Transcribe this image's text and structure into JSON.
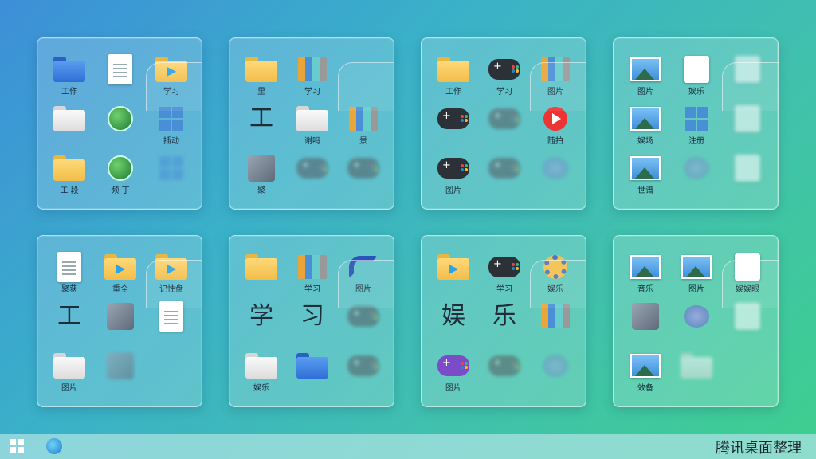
{
  "fences": [
    {
      "name": "fence-1",
      "tiles": [
        {
          "icon": "blue-folder-icon",
          "kind": "folder-blue",
          "label": "工作"
        },
        {
          "icon": "document-icon",
          "kind": "doc",
          "label": ""
        },
        {
          "icon": "media-folder-icon",
          "kind": "folder-yellow-play",
          "label": "学习"
        },
        {
          "icon": "white-folder-icon",
          "kind": "folder-white",
          "label": ""
        },
        {
          "icon": "clock-icon",
          "kind": "globe",
          "label": ""
        },
        {
          "icon": "windows-icon",
          "kind": "win",
          "label": "插动"
        },
        {
          "icon": "yellow-folder-icon",
          "kind": "folder-yellow",
          "label": "工 段"
        },
        {
          "icon": "globe-icon",
          "kind": "globe",
          "label": "频 丁"
        },
        {
          "icon": "blurred-icon",
          "kind": "win-blur",
          "label": ""
        }
      ]
    },
    {
      "name": "fence-2",
      "tiles": [
        {
          "icon": "yellow-folder-icon",
          "kind": "folder-yellow",
          "label": "里"
        },
        {
          "icon": "green-book-icon",
          "kind": "books",
          "label": "学习"
        },
        {
          "icon": "empty-icon",
          "kind": "none",
          "label": ""
        },
        {
          "icon": "work-icon",
          "kind": "char",
          "char": "工",
          "label": ""
        },
        {
          "icon": "white-folder-icon",
          "kind": "folder-white",
          "label": "谢吗"
        },
        {
          "icon": "binder-icon",
          "kind": "books",
          "label": "景"
        },
        {
          "icon": "tools-icon",
          "kind": "tool",
          "label": "聚"
        },
        {
          "icon": "blurred-gamepad-icon",
          "kind": "pad-grey-blur",
          "label": ""
        },
        {
          "icon": "blurred-gamepad-icon",
          "kind": "pad-grey-blur",
          "label": ""
        }
      ]
    },
    {
      "name": "fence-3",
      "tiles": [
        {
          "icon": "yellow-folder-icon",
          "kind": "folder-yellow",
          "label": "工作"
        },
        {
          "icon": "gamepad-icon",
          "kind": "pad",
          "label": "学习"
        },
        {
          "icon": "books-icon",
          "kind": "books",
          "label": "图片"
        },
        {
          "icon": "gamepad-icon",
          "kind": "pad",
          "label": ""
        },
        {
          "icon": "blurred-gamepad-icon",
          "kind": "pad-grey-blur",
          "label": ""
        },
        {
          "icon": "play-icon",
          "kind": "play",
          "label": "随拍"
        },
        {
          "icon": "gamepad-icon",
          "kind": "pad",
          "label": "图片"
        },
        {
          "icon": "blurred-gamepad-icon",
          "kind": "pad-grey-blur",
          "label": ""
        },
        {
          "icon": "blurred-bubble-icon",
          "kind": "bubble-blur",
          "label": ""
        }
      ]
    },
    {
      "name": "fence-4",
      "tiles": [
        {
          "icon": "picture-folder-icon",
          "kind": "pic",
          "label": "图片"
        },
        {
          "icon": "app-grid-icon",
          "kind": "panel",
          "label": "娱乐"
        },
        {
          "icon": "blurred-icon",
          "kind": "panel-blur",
          "label": ""
        },
        {
          "icon": "photo-icon",
          "kind": "pic",
          "label": "娱场"
        },
        {
          "icon": "puzzle-icon",
          "kind": "win",
          "label": "注册"
        },
        {
          "icon": "blurred-icon",
          "kind": "panel-blur",
          "label": ""
        },
        {
          "icon": "landscape-icon",
          "kind": "pic",
          "label": "世谱"
        },
        {
          "icon": "blurred-globe-icon",
          "kind": "bubble-blur",
          "label": ""
        },
        {
          "icon": "blurred-icon",
          "kind": "panel-blur",
          "label": ""
        }
      ]
    },
    {
      "name": "fence-5",
      "tiles": [
        {
          "icon": "document-icon",
          "kind": "doc",
          "label": "聚获"
        },
        {
          "icon": "media-folder-icon",
          "kind": "folder-yellow-play",
          "label": "重全"
        },
        {
          "icon": "media-folder-icon",
          "kind": "folder-yellow-play",
          "label": "记性盘"
        },
        {
          "icon": "work-icon",
          "kind": "char",
          "char": "工",
          "label": ""
        },
        {
          "icon": "tools-icon",
          "kind": "tool",
          "label": ""
        },
        {
          "icon": "calculator-icon",
          "kind": "doc",
          "label": ""
        },
        {
          "icon": "white-folder-icon",
          "kind": "folder-white",
          "label": "图片"
        },
        {
          "icon": "blurred-tools-icon",
          "kind": "tool-blur",
          "label": ""
        },
        {
          "icon": "empty-icon",
          "kind": "none",
          "label": ""
        }
      ]
    },
    {
      "name": "fence-6",
      "tiles": [
        {
          "icon": "yellow-folder-icon",
          "kind": "folder-yellow",
          "label": ""
        },
        {
          "icon": "book-stack-icon",
          "kind": "books",
          "label": "学习"
        },
        {
          "icon": "phone-icon",
          "kind": "phone",
          "label": "图片"
        },
        {
          "icon": "study-xue-icon",
          "kind": "char",
          "char": "学",
          "label": ""
        },
        {
          "icon": "study-xi-icon",
          "kind": "char",
          "char": "习",
          "label": ""
        },
        {
          "icon": "blurred-gamepad-icon",
          "kind": "pad-grey-blur",
          "label": ""
        },
        {
          "icon": "white-folder-icon",
          "kind": "folder-white",
          "label": "娱乐"
        },
        {
          "icon": "blue-folders-icon",
          "kind": "folder-blue",
          "label": ""
        },
        {
          "icon": "blurred-gamepad-icon",
          "kind": "pad-grey-blur",
          "label": ""
        }
      ]
    },
    {
      "name": "fence-7",
      "tiles": [
        {
          "icon": "media-folder-icon",
          "kind": "folder-yellow-play",
          "label": ""
        },
        {
          "icon": "gamepad-icon",
          "kind": "pad",
          "label": "学习"
        },
        {
          "icon": "settings-folder-icon",
          "kind": "gear",
          "label": "娱乐"
        },
        {
          "icon": "entertain-yu-icon",
          "kind": "char",
          "char": "娱",
          "label": ""
        },
        {
          "icon": "entertain-le-icon",
          "kind": "char",
          "char": "乐",
          "label": ""
        },
        {
          "icon": "library-icon",
          "kind": "books",
          "label": ""
        },
        {
          "icon": "purple-gamepad-icon",
          "kind": "pad-purple",
          "label": "图片"
        },
        {
          "icon": "blurred-gamepad-icon",
          "kind": "pad-grey-blur",
          "label": ""
        },
        {
          "icon": "blurred-bubble-icon",
          "kind": "bubble-blur",
          "label": ""
        }
      ]
    },
    {
      "name": "fence-8",
      "tiles": [
        {
          "icon": "picture-folder-icon",
          "kind": "pic",
          "label": "音乐"
        },
        {
          "icon": "photo-folder-icon",
          "kind": "pic",
          "label": "图片"
        },
        {
          "icon": "calendar-icon",
          "kind": "panel",
          "label": "娱娱眼"
        },
        {
          "icon": "paint-icon",
          "kind": "tool",
          "label": ""
        },
        {
          "icon": "editor-icon",
          "kind": "bubble",
          "label": ""
        },
        {
          "icon": "blurred-icon",
          "kind": "panel-blur",
          "label": ""
        },
        {
          "icon": "photo-icon",
          "kind": "pic",
          "label": "效备"
        },
        {
          "icon": "blurred-folder-icon",
          "kind": "folder-white-blur",
          "label": ""
        },
        {
          "icon": "empty-icon",
          "kind": "none",
          "label": ""
        }
      ]
    }
  ],
  "taskbar": {
    "brand": "腾讯桌面整理",
    "start_icon": "windows-start-icon",
    "browser_icon": "browser-icon"
  }
}
